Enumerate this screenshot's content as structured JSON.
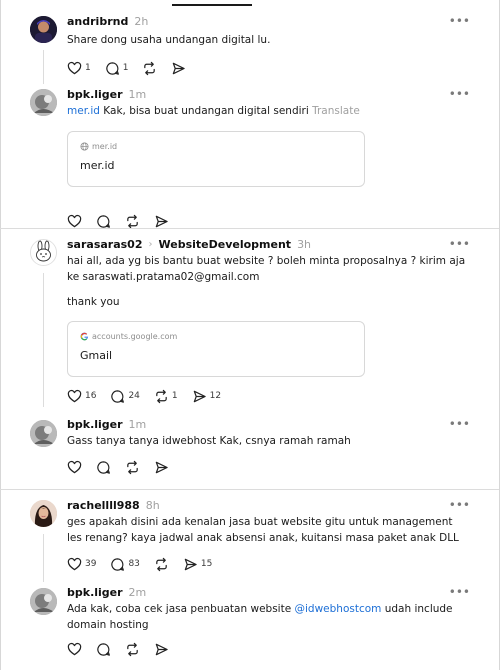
{
  "threads": [
    {
      "main": {
        "username": "andribrnd",
        "time": "2h",
        "text": "Share dong usaha undangan digital lu.",
        "likes": "1",
        "replies": "1"
      },
      "reply": {
        "username": "bpk.liger",
        "time": "1m",
        "link_text": "mer.id",
        "text": " Kak, bisa buat undangan digital sendiri",
        "translate": "Translate",
        "card": {
          "domain": "mer.id",
          "title": "mer.id"
        }
      }
    },
    {
      "main": {
        "username": "sarasaras02",
        "community": "WebsiteDevelopment",
        "time": "3h",
        "text": "hai all, ada yg bis bantu buat website ? boleh minta proposalnya ? kirim aja ke saraswati.pratama02@gmail.com",
        "text2": "thank you",
        "card": {
          "domain": "accounts.google.com",
          "title": "Gmail"
        },
        "likes": "16",
        "replies": "24",
        "reposts": "1",
        "shares": "12"
      },
      "reply": {
        "username": "bpk.liger",
        "time": "1m",
        "text": "Gass tanya tanya idwebhost Kak, csnya ramah ramah"
      }
    },
    {
      "main": {
        "username": "rachellll988",
        "time": "8h",
        "text": "ges apakah disini ada kenalan jasa buat website gitu untuk management les renang? kaya jadwal anak absensi anak, kuitansi masa paket anak DLL",
        "likes": "39",
        "replies": "83",
        "shares": "15"
      },
      "reply": {
        "username": "bpk.liger",
        "time": "2m",
        "text_before": "Ada kak, coba cek jasa penbuatan website ",
        "mention": "@idwebhostcom",
        "text_after": " udah include domain hosting"
      }
    }
  ],
  "ui": {
    "more": "•••",
    "chevron": "›"
  },
  "colors": {
    "link": "#1d6fd6",
    "muted": "#a0a0a0",
    "divider": "#dcdcdc"
  },
  "icons": [
    "heart-icon",
    "comment-icon",
    "repost-icon",
    "share-icon",
    "globe-icon",
    "google-icon",
    "more-icon"
  ]
}
